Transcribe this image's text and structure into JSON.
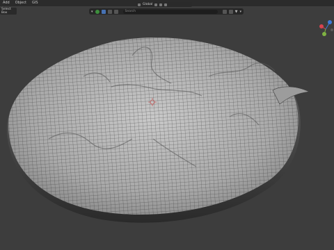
{
  "menubar": {
    "items": [
      "Add",
      "Object",
      "GIS"
    ]
  },
  "toolbar": {
    "select_mode": "Select Box"
  },
  "header": {
    "pivot_label": "Global",
    "search_placeholder": "Search"
  },
  "viewport": {
    "mesh_color": "#b8b8b8",
    "wire_color": "#2a2a2a",
    "background_color": "#3d3d3d"
  },
  "gizmo": {
    "axes": [
      "x",
      "y",
      "z"
    ],
    "x_color": "#d9434f",
    "y_color": "#7fb342",
    "z_color": "#3d7ad9"
  }
}
